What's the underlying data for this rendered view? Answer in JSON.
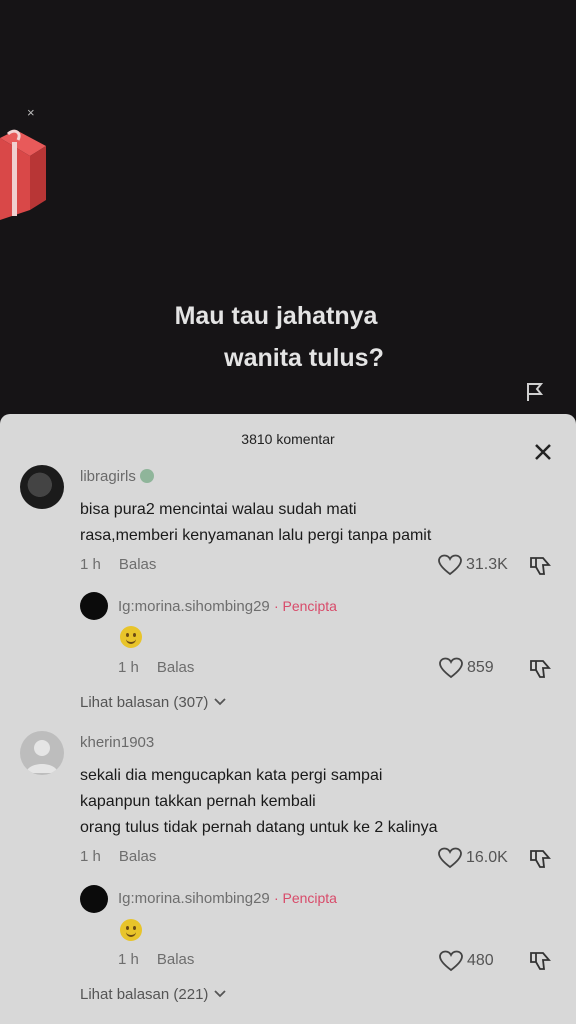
{
  "video": {
    "caption_line1": "Mau tau jahatnya",
    "caption_line2": "wanita tulus?",
    "gift_close": "×"
  },
  "sheet": {
    "title": "3810 komentar"
  },
  "comments": [
    {
      "username": "libragirls",
      "text_lines": [
        "bisa pura2 mencintai walau sudah mati",
        "rasa,memberi kenyamanan lalu pergi tanpa pamit"
      ],
      "time": "1 h",
      "reply_label": "Balas",
      "likes": "31.3K",
      "reply": {
        "username": "Ig:morina.sihombing29",
        "tag": "· Pencipta",
        "time": "1 h",
        "reply_label": "Balas",
        "likes": "859"
      },
      "more_replies": "Lihat balasan (307)"
    },
    {
      "username": "kherin1903",
      "text_lines": [
        "sekali dia mengucapkan kata pergi sampai",
        "kapanpun takkan pernah kembali",
        "orang tulus tidak pernah datang untuk ke 2 kalinya"
      ],
      "time": "1 h",
      "reply_label": "Balas",
      "likes": "16.0K",
      "reply": {
        "username": "Ig:morina.sihombing29",
        "tag": "· Pencipta",
        "time": "1 h",
        "reply_label": "Balas",
        "likes": "480"
      },
      "more_replies": "Lihat balasan (221)"
    }
  ]
}
